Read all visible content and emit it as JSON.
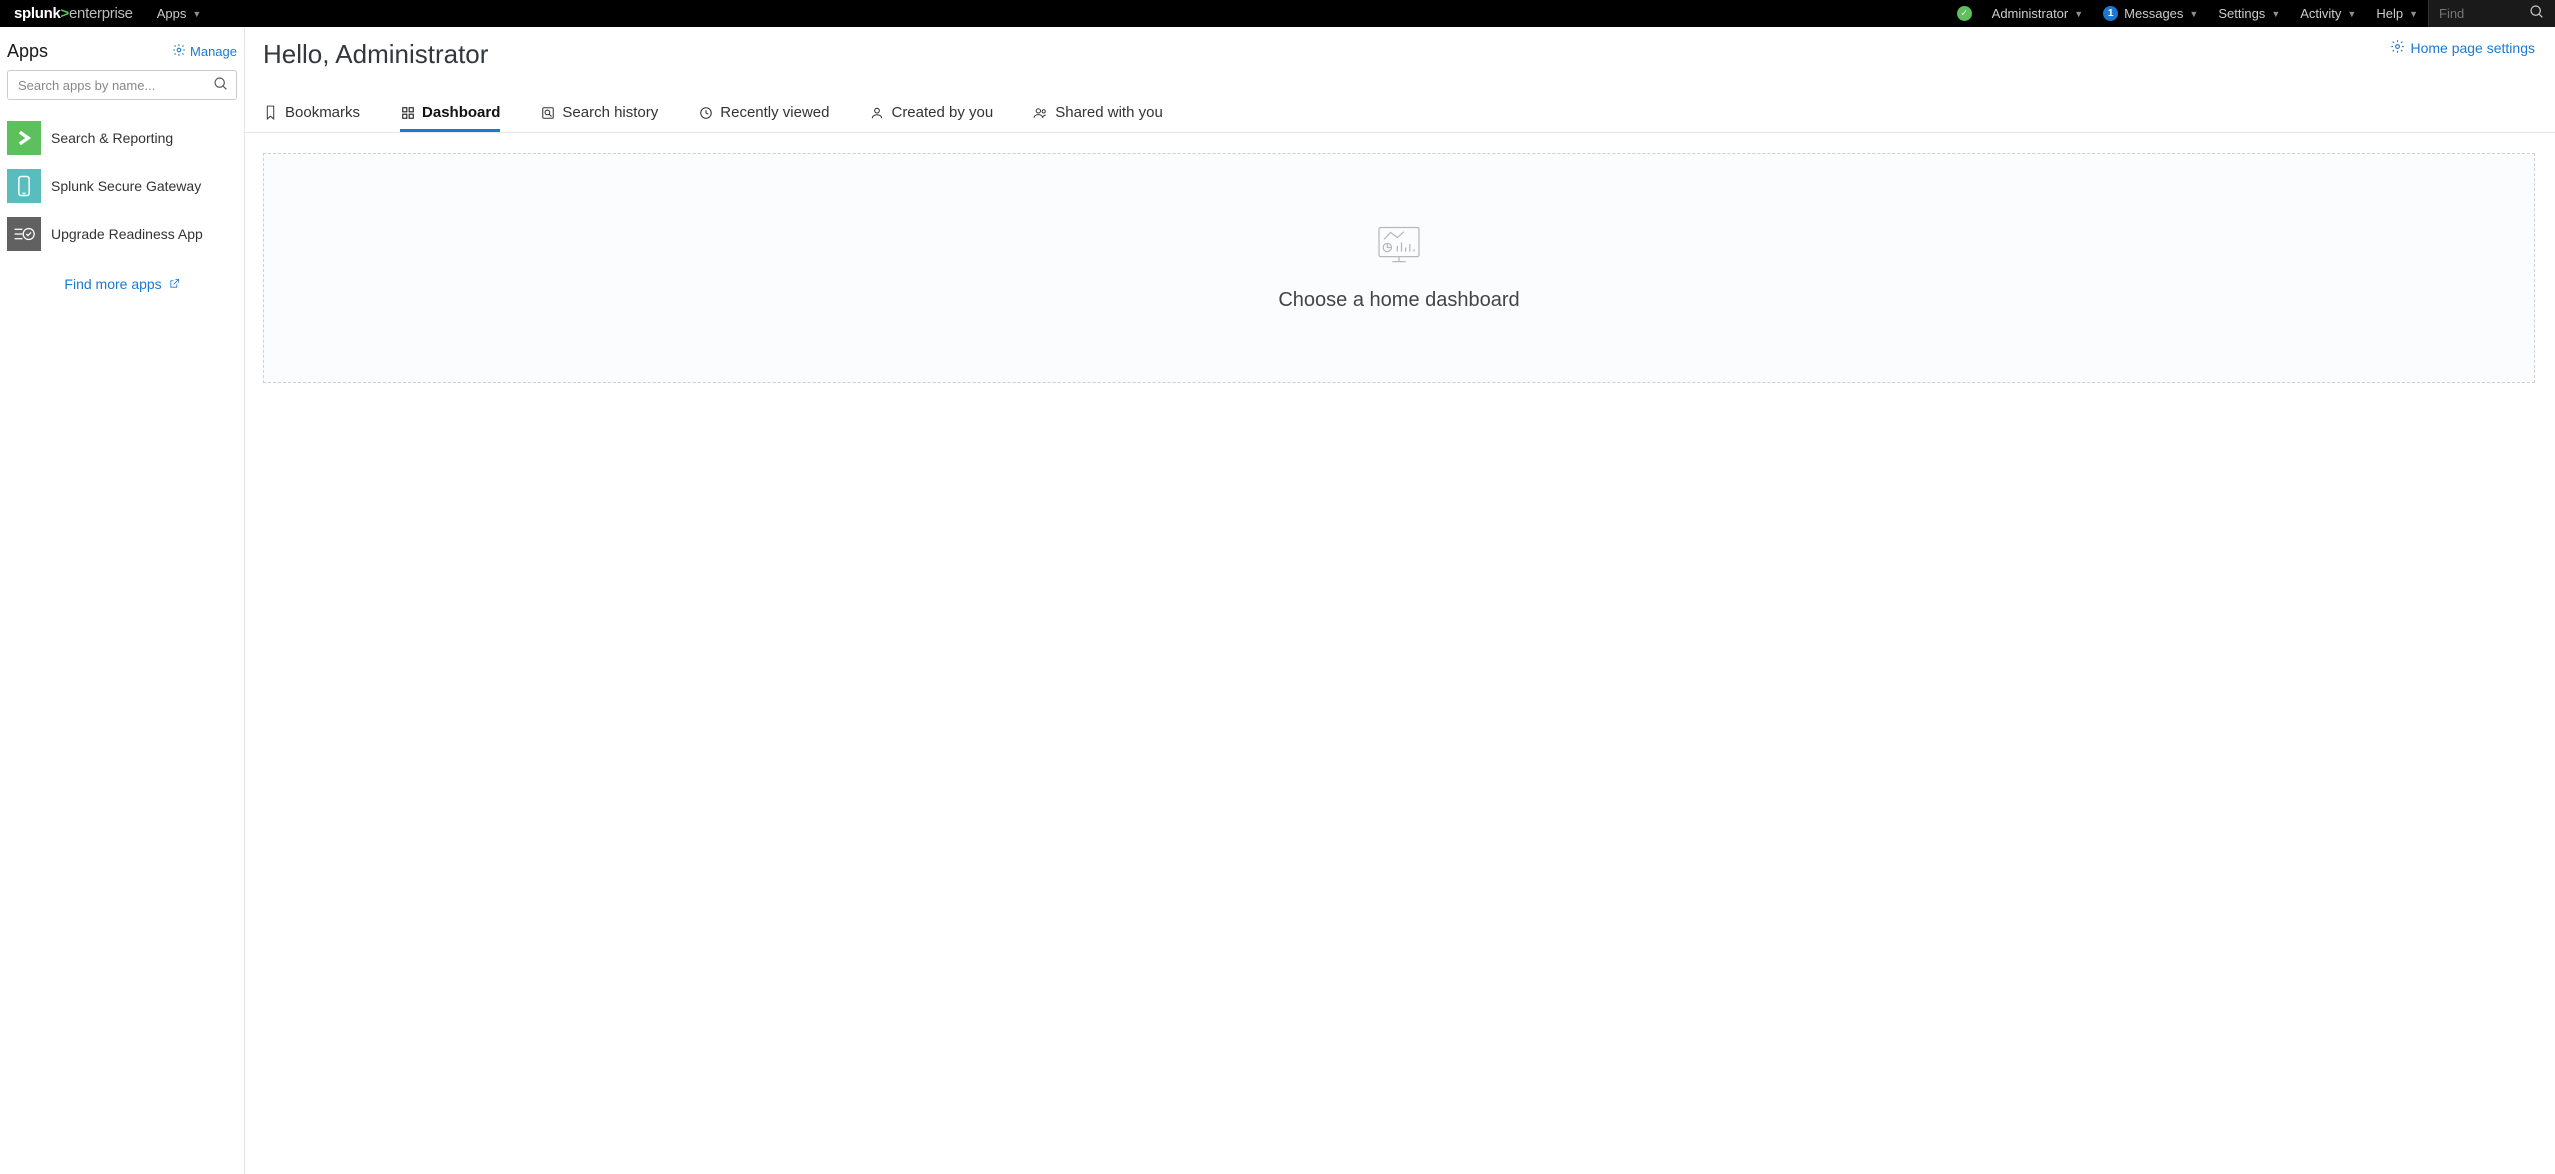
{
  "top_nav": {
    "brand_splunk": "splunk",
    "brand_caret": ">",
    "brand_enterprise": "enterprise",
    "apps_label": "Apps",
    "user_label": "Administrator",
    "messages_label": "Messages",
    "messages_badge": "1",
    "settings_label": "Settings",
    "activity_label": "Activity",
    "help_label": "Help",
    "find_placeholder": "Find"
  },
  "sidebar": {
    "title": "Apps",
    "manage_label": "Manage",
    "search_placeholder": "Search apps by name...",
    "items": [
      {
        "label": "Search & Reporting"
      },
      {
        "label": "Splunk Secure Gateway"
      },
      {
        "label": "Upgrade Readiness App"
      }
    ],
    "find_more_label": "Find more apps"
  },
  "main": {
    "greeting": "Hello, Administrator",
    "home_settings_label": "Home page settings",
    "tabs": [
      {
        "label": "Bookmarks"
      },
      {
        "label": "Dashboard"
      },
      {
        "label": "Search history"
      },
      {
        "label": "Recently viewed"
      },
      {
        "label": "Created by you"
      },
      {
        "label": "Shared with you"
      }
    ],
    "active_tab_index": 1,
    "empty_message": "Choose a home dashboard"
  }
}
